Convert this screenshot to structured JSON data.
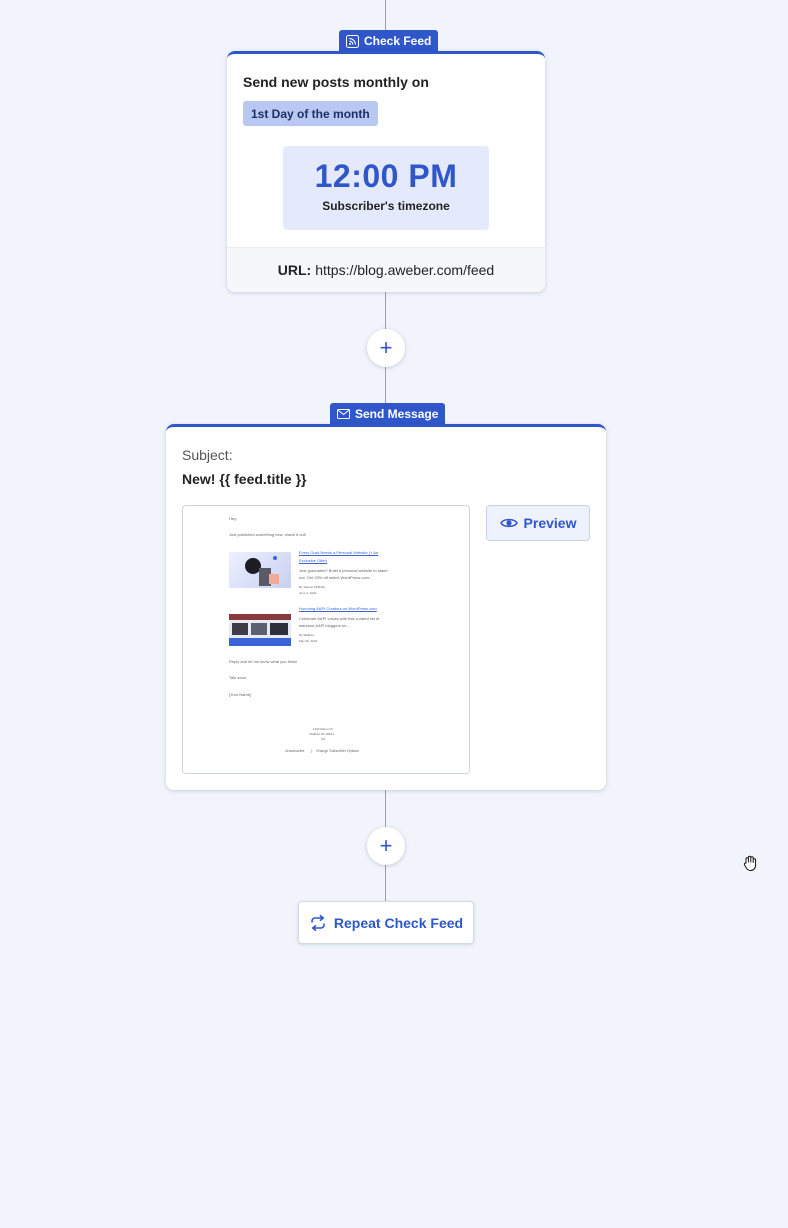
{
  "check_feed": {
    "tag_label": "Check Feed",
    "title": "Send new posts monthly on",
    "day_pill": "1st Day of the month",
    "time": "12:00 PM",
    "timezone": "Subscriber's timezone",
    "url_label": "URL:",
    "url_value": "https://blog.aweber.com/feed"
  },
  "add_step": {
    "symbol": "+"
  },
  "send_message": {
    "tag_label": "Send Message",
    "subject_label": "Subject:",
    "subject_value": "New! {{ feed.title }}",
    "preview_button": "Preview",
    "email_preview": {
      "greeting": "Hey,",
      "intro": "Just published something new, check it out!",
      "posts": [
        {
          "title_line1": "Every Grad Needs a Personal Website (+ An",
          "title_line2": "Exclusive Offer)",
          "excerpt_line1": "Just graduated? Build a personal website to stand",
          "excerpt_line2": "out. Get 20% off select WordPress.com...",
          "author": "By Jeanne McBride",
          "date": "June 4, 2024"
        },
        {
          "title_line1": "Honoring AAPI Creators on WordPress.com",
          "title_line2": "",
          "excerpt_line1": "Celebrate AAPI voices with this curated list of",
          "excerpt_line2": "standout AAPI bloggers on...",
          "author": "By Wallace",
          "date": "May 30, 2024"
        }
      ],
      "closing": "Reply and let me know what you think!",
      "signoff": "Talk soon,",
      "signature": "[Your Name]",
      "address_line1": "1100 Manor Dr",
      "address_line2": "Chalfont PA 18914",
      "address_line3": "US",
      "unsubscribe": "Unsubscribe",
      "separator": "|",
      "change_options": "Change Subscriber Options"
    }
  },
  "repeat": {
    "label": "Repeat Check Feed"
  },
  "colors": {
    "accent": "#2f57c9",
    "background": "#f1f4fb",
    "pill": "#b9c8f2"
  }
}
